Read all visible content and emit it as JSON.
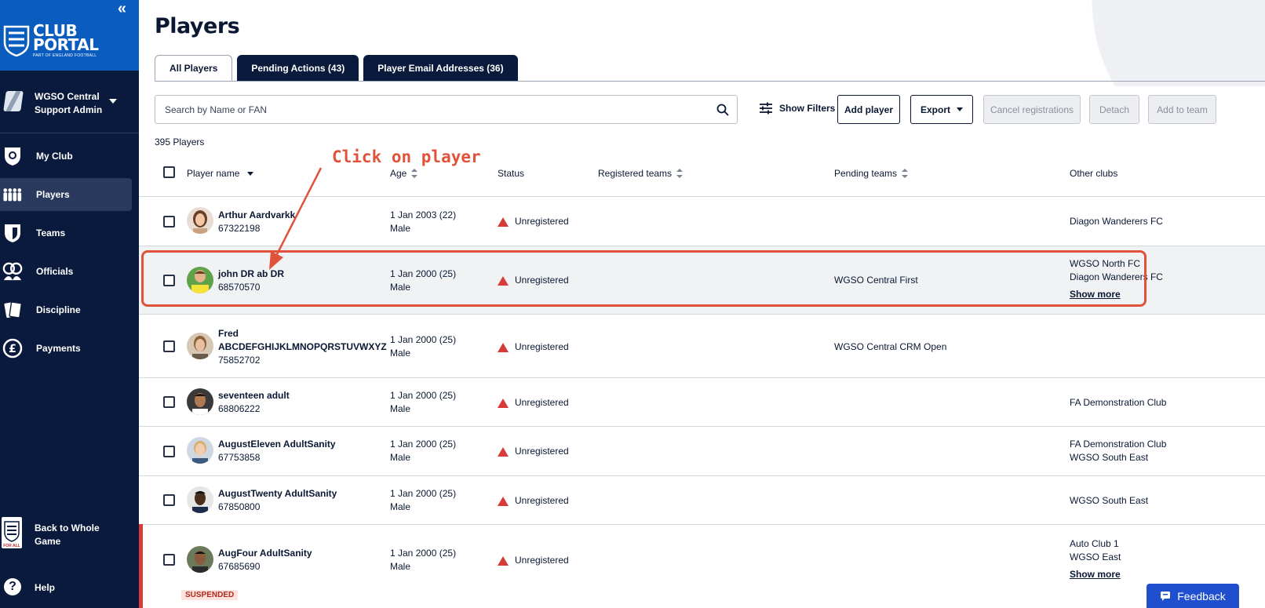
{
  "sidebar": {
    "collapse_glyph": "«",
    "logo": {
      "line1": "CLUB",
      "line2": "PORTAL",
      "sub": "PART OF ENGLAND FOOTBALL"
    },
    "org": {
      "line1": "WGSO Central",
      "line2": "Support Admin"
    },
    "nav": [
      {
        "label": "My Club",
        "icon": "shield-ball-icon"
      },
      {
        "label": "Players",
        "icon": "players-icon"
      },
      {
        "label": "Teams",
        "icon": "shield-icon"
      },
      {
        "label": "Officials",
        "icon": "officials-icon"
      },
      {
        "label": "Discipline",
        "icon": "cards-icon"
      },
      {
        "label": "Payments",
        "icon": "pound-icon"
      }
    ],
    "back": {
      "line1": "Back to Whole",
      "line2": "Game",
      "crest_text": "FOR ALL"
    },
    "help": {
      "glyph": "?",
      "label": "Help"
    }
  },
  "main": {
    "title": "Players",
    "tabs": [
      {
        "label": "All Players"
      },
      {
        "label": "Pending Actions (43)"
      },
      {
        "label": "Player Email Addresses (36)"
      }
    ],
    "search": {
      "placeholder": "Search by Name or FAN"
    },
    "show_filters": "Show Filters",
    "buttons": {
      "add_player": "Add player",
      "export": "Export",
      "cancel_registrations": "Cancel registrations",
      "detach": "Detach",
      "add_to_team": "Add to team"
    },
    "count": "395 Players",
    "columns": {
      "player_name": "Player name",
      "age": "Age",
      "status": "Status",
      "registered_teams": "Registered teams",
      "pending_teams": "Pending teams",
      "other_clubs": "Other clubs"
    },
    "rows": [
      {
        "name": "Arthur Aardvarkk",
        "fan": "67322198",
        "dob": "1 Jan 2003 (22)",
        "gender": "Male",
        "status": "Unregistered",
        "pending": "",
        "clubs": [
          "Diagon Wanderers FC"
        ],
        "show_more": ""
      },
      {
        "name": "john DR ab DR",
        "fan": "68570570",
        "dob": "1 Jan 2000 (25)",
        "gender": "Male",
        "status": "Unregistered",
        "pending": "WGSO Central First",
        "clubs": [
          "WGSO North FC",
          "Diagon Wanderers FC"
        ],
        "show_more": "Show more"
      },
      {
        "name": "Fred",
        "name2": "ABCDEFGHIJKLMNOPQRSTUVWXYZ",
        "fan": "75852702",
        "dob": "1 Jan 2000 (25)",
        "gender": "Male",
        "status": "Unregistered",
        "pending": "WGSO Central CRM Open",
        "clubs": [],
        "show_more": ""
      },
      {
        "name": "seventeen adult",
        "fan": "68806222",
        "dob": "1 Jan 2000 (25)",
        "gender": "Male",
        "status": "Unregistered",
        "pending": "",
        "clubs": [
          "FA Demonstration Club"
        ],
        "show_more": ""
      },
      {
        "name": "AugustEleven AdultSanity",
        "fan": "67753858",
        "dob": "1 Jan 2000 (25)",
        "gender": "Male",
        "status": "Unregistered",
        "pending": "",
        "clubs": [
          "FA Demonstration Club",
          "WGSO South East"
        ],
        "show_more": ""
      },
      {
        "name": "AugustTwenty AdultSanity",
        "fan": "67850800",
        "dob": "1 Jan 2000 (25)",
        "gender": "Male",
        "status": "Unregistered",
        "pending": "",
        "clubs": [
          "WGSO South East"
        ],
        "show_more": ""
      },
      {
        "name": "AugFour AdultSanity",
        "fan": "67685690",
        "dob": "1 Jan 2000 (25)",
        "gender": "Male",
        "status": "Unregistered",
        "pending": "",
        "clubs": [
          "Auto Club 1",
          "WGSO East"
        ],
        "show_more": "Show more",
        "badge": "SUSPENDED"
      }
    ]
  },
  "annotation": {
    "text": "Click on player",
    "color": "#e0533a"
  },
  "feedback": {
    "label": "Feedback"
  },
  "colors": {
    "navy": "#0a1a3c",
    "brand_blue": "#0b5cbf",
    "status_red": "#d93a3a",
    "feedback_blue": "#1f4fcf"
  }
}
